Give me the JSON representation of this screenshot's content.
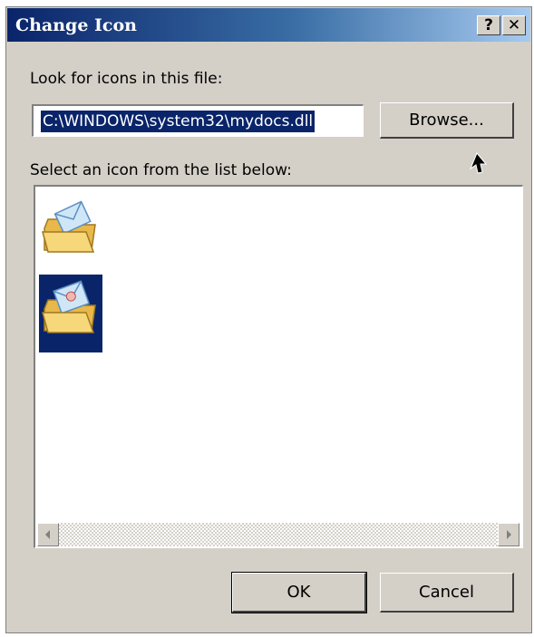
{
  "window": {
    "title": "Change Icon",
    "help_label": "?",
    "close_label": "✕"
  },
  "file_label": "Look for icons in this file:",
  "file_path": "C:\\WINDOWS\\system32\\mydocs.dll",
  "browse_label": "Browse...",
  "list_label": "Select an icon from the list below:",
  "icons": [
    {
      "name": "folder-envelope-icon",
      "selected": false
    },
    {
      "name": "folder-person-icon",
      "selected": true
    }
  ],
  "buttons": {
    "ok_label": "OK",
    "cancel_label": "Cancel"
  },
  "colors": {
    "title_start": "#0a246a",
    "title_end": "#a6caf0",
    "selection": "#0a246a",
    "dialog_bg": "#d4d0c8"
  }
}
